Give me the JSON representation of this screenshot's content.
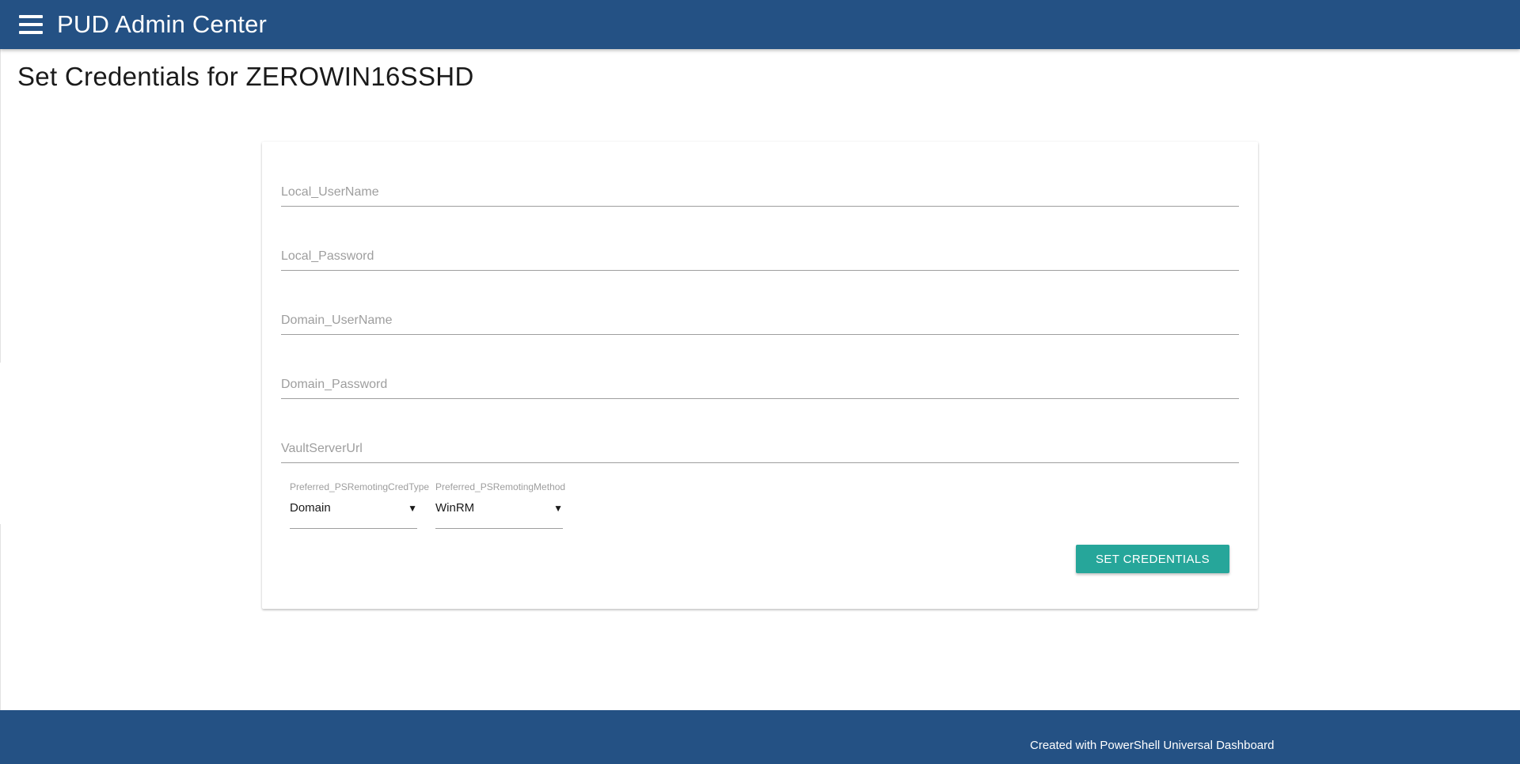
{
  "header": {
    "app_title": "PUD Admin Center",
    "menu_icon": "hamburger-menu-icon"
  },
  "page": {
    "title": "Set Credentials for ZEROWIN16SSHD"
  },
  "form": {
    "fields": [
      {
        "placeholder": "Local_UserName",
        "value": ""
      },
      {
        "placeholder": "Local_Password",
        "value": ""
      },
      {
        "placeholder": "Domain_UserName",
        "value": ""
      },
      {
        "placeholder": "Domain_Password",
        "value": ""
      },
      {
        "placeholder": "VaultServerUrl",
        "value": ""
      }
    ],
    "selects": [
      {
        "label": "Preferred_PSRemotingCredType",
        "value": "Domain"
      },
      {
        "label": "Preferred_PSRemotingMethod",
        "value": "WinRM"
      }
    ],
    "submit_label": "SET CREDENTIALS",
    "caret_glyph": "▼"
  },
  "footer": {
    "text": "Created with PowerShell Universal Dashboard"
  },
  "colors": {
    "navbar": "#245184",
    "accent": "#26a69a"
  }
}
